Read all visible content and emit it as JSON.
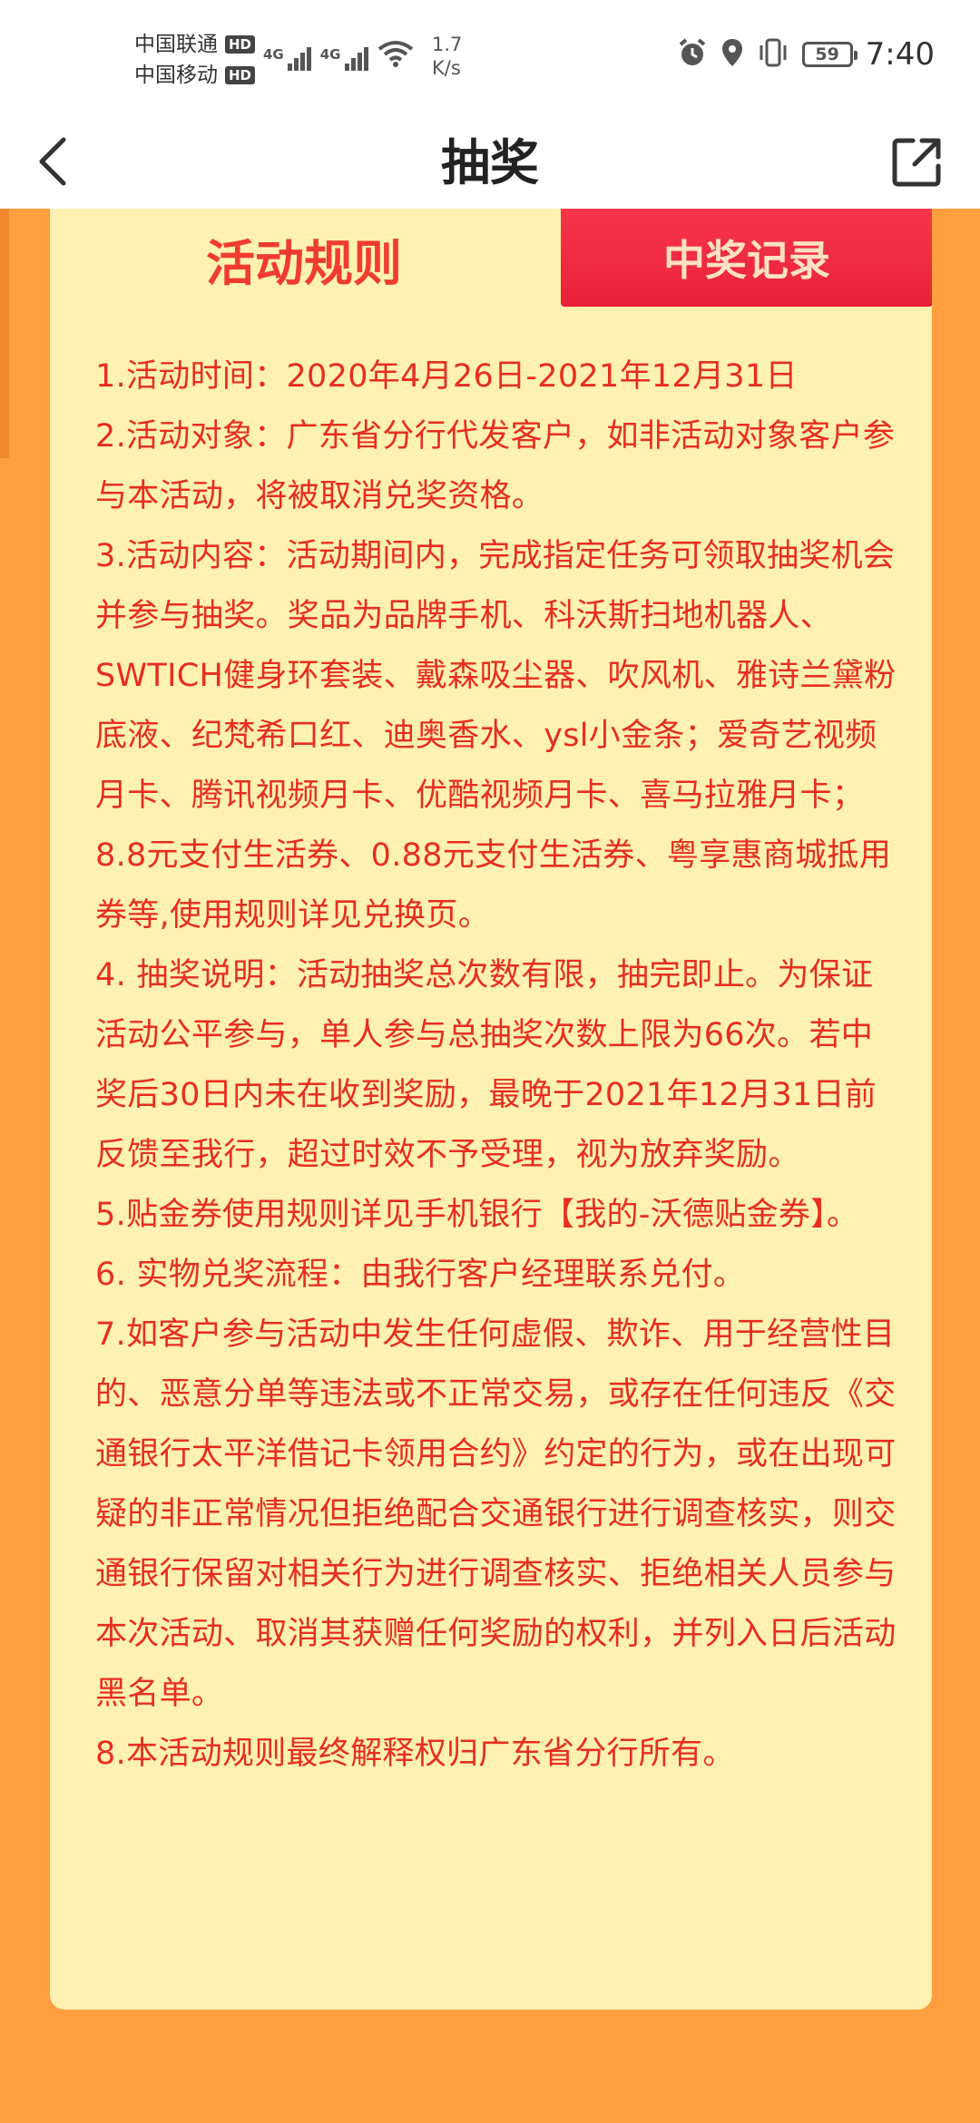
{
  "status_bar": {
    "carrier1": "中国联通",
    "carrier2": "中国移动",
    "hd": "HD",
    "network1": "4G",
    "network2": "4G",
    "speed_value": "1.7",
    "speed_unit": "K/s",
    "battery": "59",
    "time": "7:40",
    "icons": [
      "alarm-icon",
      "location-icon",
      "vibrate-icon",
      "battery-icon",
      "wifi-icon",
      "signal-icon"
    ]
  },
  "header": {
    "title": "抽奖",
    "back_icon": "chevron-left-icon",
    "share_icon": "share-out-icon"
  },
  "tabs": {
    "rules": "活动规则",
    "records": "中奖记录"
  },
  "rules": [
    "1.活动时间：2020年4月26日-2021年12月31日",
    "2.活动对象：广东省分行代发客户，如非活动对象客户参与本活动，将被取消兑奖资格。",
    "3.活动内容：活动期间内，完成指定任务可领取抽奖机会并参与抽奖。奖品为品牌手机、科沃斯扫地机器人、SWTICH健身环套装、戴森吸尘器、吹风机、雅诗兰黛粉底液、纪梵希口红、迪奥香水、ysl小金条；爱奇艺视频月卡、腾讯视频月卡、优酷视频月卡、喜马拉雅月卡；8.8元支付生活券、0.88元支付生活券、粤享惠商城抵用券等,使用规则详见兑换页。",
    "4. 抽奖说明：活动抽奖总次数有限，抽完即止。为保证活动公平参与，单人参与总抽奖次数上限为66次。若中奖后30日内未在收到奖励，最晚于2021年12月31日前反馈至我行，超过时效不予受理，视为放弃奖励。",
    "5.贴金券使用规则详见手机银行【我的-沃德贴金券】。",
    "6. 实物兑奖流程：由我行客户经理联系兑付。",
    "7.如客户参与活动中发生任何虚假、欺诈、用于经营性目的、恶意分单等违法或不正常交易，或存在任何违反《交通银行太平洋借记卡领用合约》约定的行为，或在出现可疑的非正常情况但拒绝配合交通银行进行调查核实，则交通银行保留对相关行为进行调查核实、拒绝相关人员参与本次活动、取消其获赠任何奖励的权利，并列入日后活动黑名单。",
    "8.本活动规则最终解释权归广东省分行所有。"
  ],
  "colors": {
    "page_background": "#ff9f3f",
    "card_background": "#fef1b2",
    "rules_text": "#e82e1e",
    "records_tab": "#f02a40"
  }
}
